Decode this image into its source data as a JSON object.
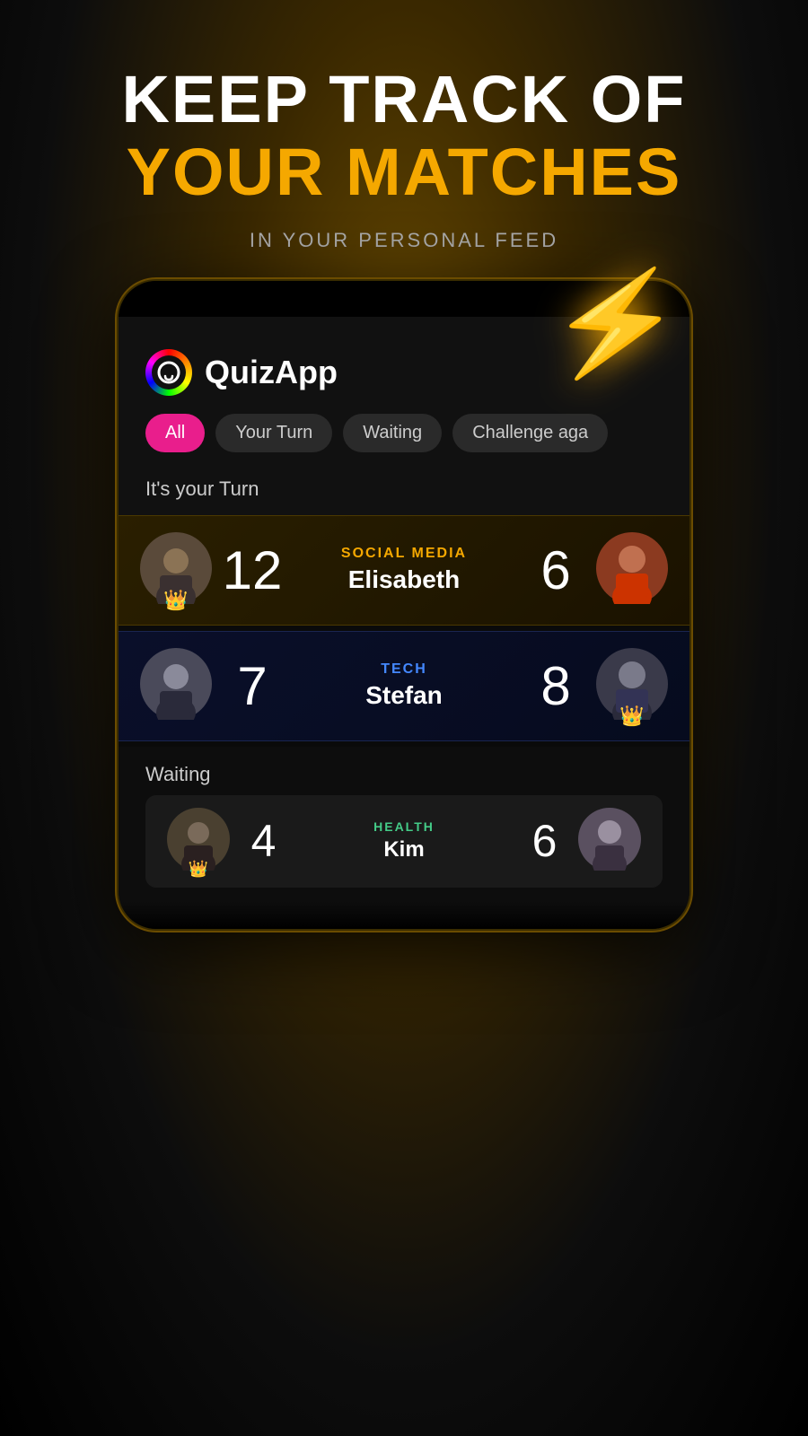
{
  "hero": {
    "line1": "KEEP TRACK OF",
    "line2": "YOUR MATCHES",
    "subtitle": "IN YOUR PERSONAL FEED"
  },
  "app": {
    "name": "QuizApp"
  },
  "tabs": [
    {
      "label": "All",
      "active": true
    },
    {
      "label": "Your Turn",
      "active": false
    },
    {
      "label": "Waiting",
      "active": false
    },
    {
      "label": "Challenge aga",
      "active": false
    }
  ],
  "your_turn_label": "It's your Turn",
  "matches_your_turn": [
    {
      "category": "SOCIAL MEDIA",
      "opponent": "Elisabeth",
      "my_score": "12",
      "their_score": "6",
      "i_lead": true,
      "type": "gold"
    },
    {
      "category": "TECH",
      "opponent": "Stefan",
      "my_score": "7",
      "their_score": "8",
      "i_lead": false,
      "type": "blue"
    }
  ],
  "waiting_label": "Waiting",
  "matches_waiting": [
    {
      "category": "HEALTH",
      "opponent": "Kim",
      "my_score": "4",
      "their_score": "6",
      "i_lead": false,
      "type": "dark"
    }
  ],
  "lightning": "⚡"
}
